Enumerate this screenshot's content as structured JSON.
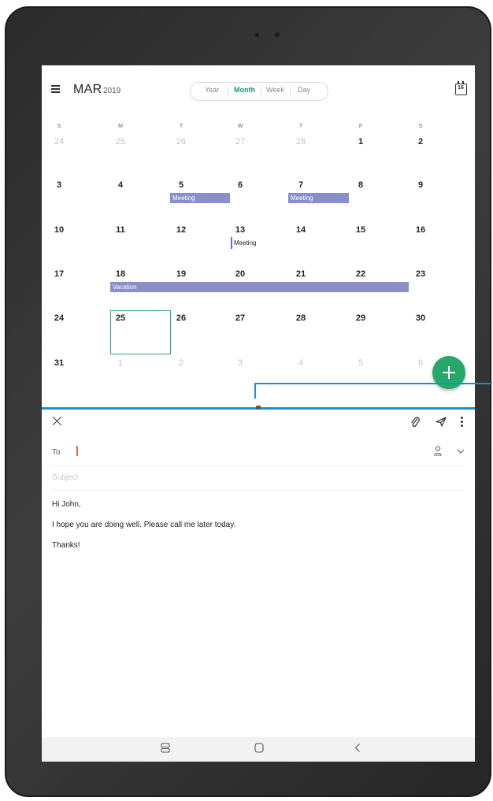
{
  "header": {
    "month": "MAR",
    "year": "2019",
    "views": [
      "Year",
      "Month",
      "Week",
      "Day"
    ],
    "active_view": "Month",
    "today_number": "16"
  },
  "calendar": {
    "weekdays": [
      "S",
      "M",
      "T",
      "W",
      "T",
      "F",
      "S"
    ],
    "weeks": [
      [
        "24",
        "25",
        "26",
        "27",
        "28",
        "1",
        "2"
      ],
      [
        "3",
        "4",
        "5",
        "6",
        "7",
        "8",
        "9"
      ],
      [
        "10",
        "11",
        "12",
        "13",
        "14",
        "15",
        "16"
      ],
      [
        "17",
        "18",
        "19",
        "20",
        "21",
        "22",
        "23"
      ],
      [
        "24",
        "25",
        "26",
        "27",
        "28",
        "29",
        "30"
      ],
      [
        "31",
        "1",
        "2",
        "3",
        "4",
        "5",
        "6"
      ]
    ],
    "selected_date": "25",
    "events": [
      {
        "label": "Meeting",
        "date": "5"
      },
      {
        "label": "Meeting",
        "date": "7"
      },
      {
        "label": "Meeting",
        "date": "13"
      },
      {
        "label": "Vacation",
        "start": "18",
        "end": "23"
      }
    ]
  },
  "email": {
    "to_label": "To",
    "subject_placeholder": "Subject",
    "body": [
      "Hi John,",
      "I hope you are doing well. Please call me later today.",
      "Thanks!"
    ]
  },
  "colors": {
    "accent_green": "#26a86b",
    "event_purple": "#8a8fcc",
    "divider_blue": "#1a8fd0",
    "cursor_orange": "#e86b3a"
  },
  "icons": {
    "menu": "menu-icon",
    "today": "calendar-today-icon",
    "add": "add-icon",
    "close": "close-icon",
    "attach": "paperclip-icon",
    "send": "send-icon",
    "more": "more-options-icon",
    "contact": "person-icon",
    "expand": "chevron-down-icon",
    "nav_recents": "recents-icon",
    "nav_home": "home-icon",
    "nav_back": "back-icon"
  }
}
